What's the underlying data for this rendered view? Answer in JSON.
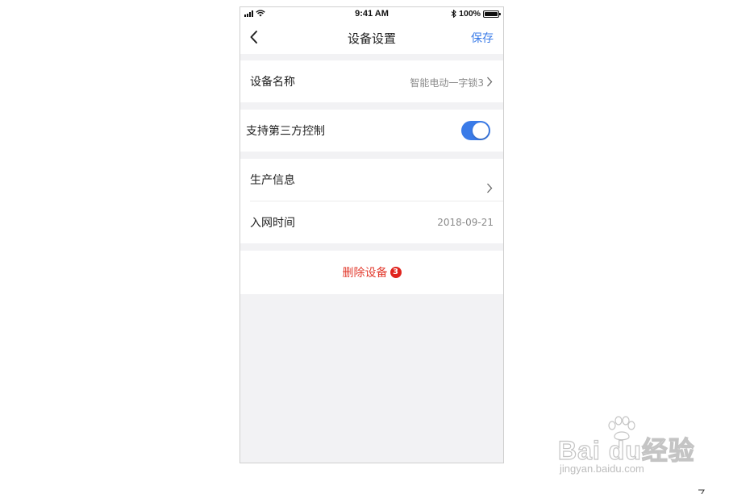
{
  "status_bar": {
    "time": "9:41 AM",
    "battery": "100%",
    "icons": [
      "signal-icon",
      "wifi-icon",
      "bluetooth-icon",
      "battery-icon"
    ]
  },
  "nav": {
    "title": "设备设置",
    "save_label": "保存",
    "back_icon": "chevron-left-icon"
  },
  "settings": {
    "device_name": {
      "label": "设备名称",
      "value": "智能电动一字锁3"
    },
    "third_party": {
      "label": "支持第三方控制",
      "enabled": true
    },
    "production_info": {
      "label": "生产信息"
    },
    "network_time": {
      "label": "入网时间",
      "value": "2018-09-21"
    }
  },
  "delete": {
    "label": "删除设备",
    "step_badge": "3"
  },
  "watermark": {
    "logo_text": "Bai du经验",
    "url": "jingyan.baidu.com"
  },
  "colors": {
    "accent": "#3a7be8",
    "danger": "#e23b2e",
    "background": "#f2f2f4"
  }
}
